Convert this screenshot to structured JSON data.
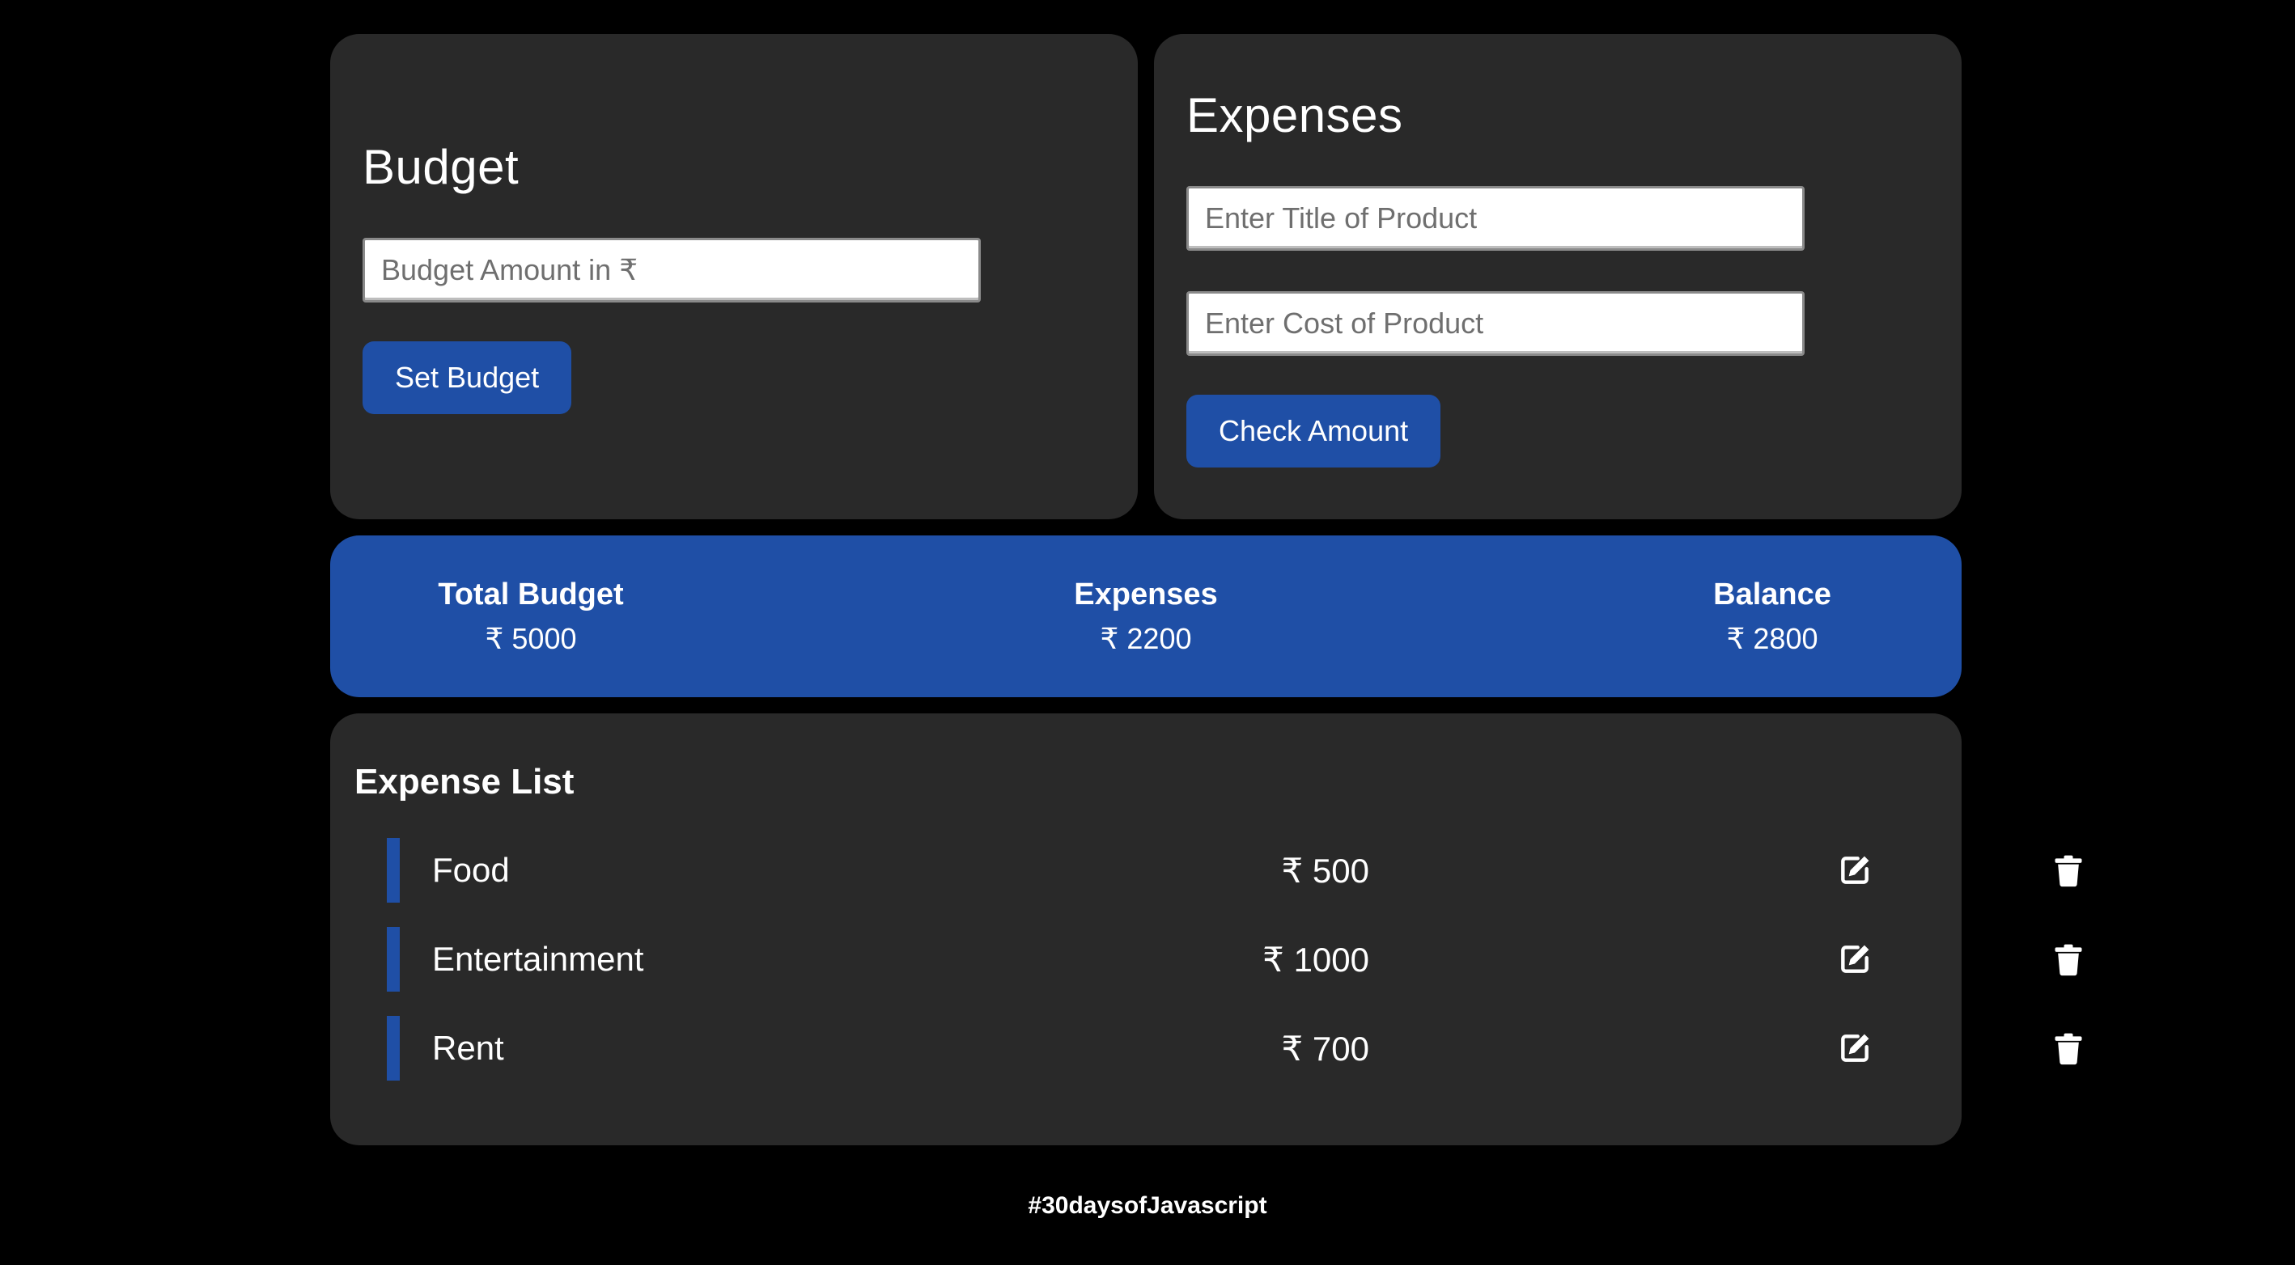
{
  "colors": {
    "page_bg": "#000000",
    "card_bg": "#292929",
    "accent": "#1f4fa6",
    "text": "#ffffff"
  },
  "budget": {
    "title": "Budget",
    "amount_placeholder": "Budget Amount in ₹",
    "amount_value": "",
    "button_label": "Set Budget"
  },
  "expenses": {
    "title": "Expenses",
    "product_title_placeholder": "Enter Title of Product",
    "product_title_value": "",
    "product_cost_placeholder": "Enter Cost of Product",
    "product_cost_value": "",
    "button_label": "Check Amount"
  },
  "summary": {
    "total_budget_label": "Total Budget",
    "total_budget_value": "₹ 5000",
    "expenses_label": "Expenses",
    "expenses_value": "₹ 2200",
    "balance_label": "Balance",
    "balance_value": "₹ 2800"
  },
  "expense_list": {
    "title": "Expense List",
    "items": [
      {
        "title": "Food",
        "amount": "₹ 500",
        "edit_icon": "edit-icon",
        "delete_icon": "trash-icon"
      },
      {
        "title": "Entertainment",
        "amount": "₹ 1000",
        "edit_icon": "edit-icon",
        "delete_icon": "trash-icon"
      },
      {
        "title": "Rent",
        "amount": "₹ 700",
        "edit_icon": "edit-icon",
        "delete_icon": "trash-icon"
      }
    ]
  },
  "footer": {
    "tag": "#30daysofJavascript"
  }
}
